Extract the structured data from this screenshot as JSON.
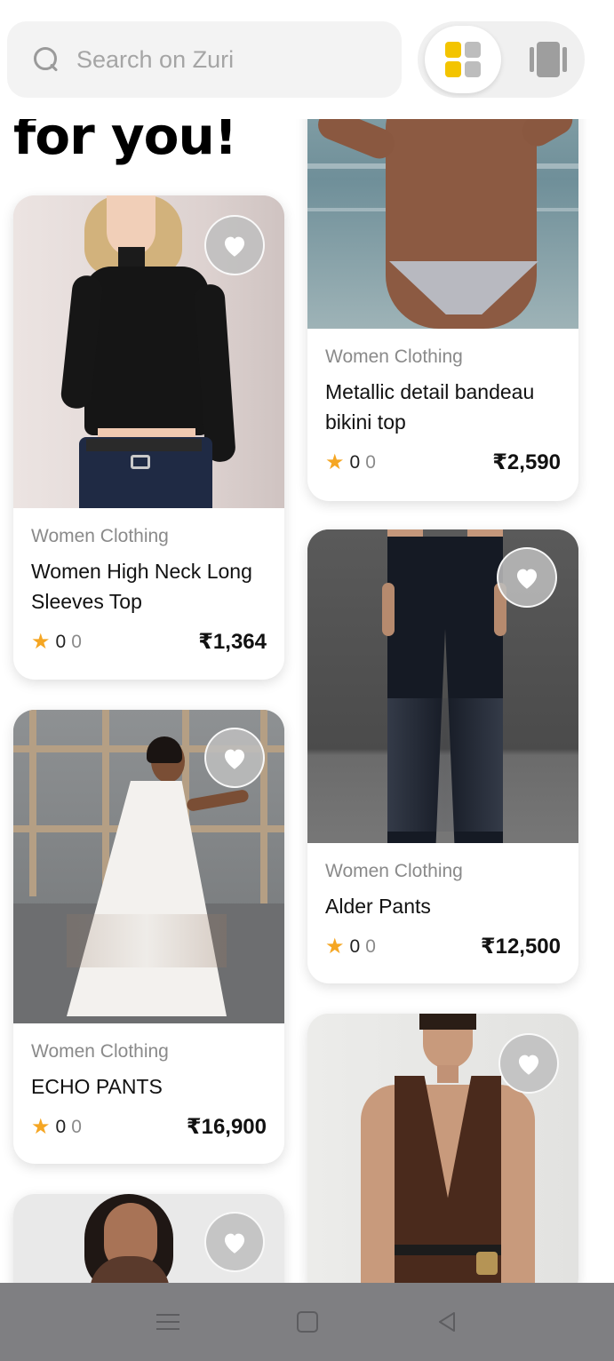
{
  "search": {
    "placeholder": "Search on Zuri"
  },
  "view_toggle": {
    "active": "grid",
    "grid_color": "#f3c400"
  },
  "heading": "for you!",
  "products": [
    {
      "category": "Women Clothing",
      "title": "Women High Neck Long Sleeves Top",
      "rating": "0",
      "reviews": "0",
      "price": "₹1,364"
    },
    {
      "category": "Women Clothing",
      "title": "Metallic detail bandeau bikini top",
      "rating": "0",
      "reviews": "0",
      "price": "₹2,590"
    },
    {
      "category": "Women Clothing",
      "title": "ECHO PANTS",
      "rating": "0",
      "reviews": "0",
      "price": "₹16,900"
    },
    {
      "category": "Women Clothing",
      "title": "Alder Pants",
      "rating": "0",
      "reviews": "0",
      "price": "₹12,500"
    }
  ],
  "icons": {
    "star": "star-icon",
    "heart": "heart-icon"
  },
  "colors": {
    "star": "#f5a623",
    "navbar": "#7f7f82"
  }
}
